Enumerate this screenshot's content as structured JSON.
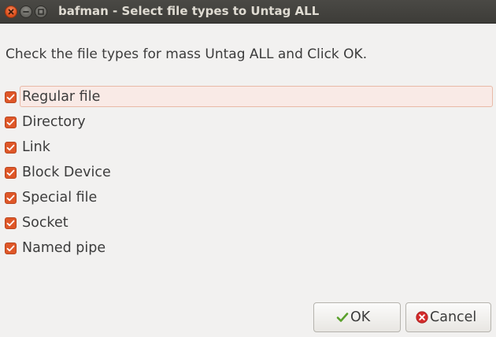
{
  "window": {
    "title": "bafman - Select file types to Untag ALL"
  },
  "instruction": "Check the file types for mass Untag ALL and Click OK.",
  "options": [
    {
      "label": "Regular file",
      "checked": true,
      "focused": true
    },
    {
      "label": "Directory",
      "checked": true,
      "focused": false
    },
    {
      "label": "Link",
      "checked": true,
      "focused": false
    },
    {
      "label": "Block Device",
      "checked": true,
      "focused": false
    },
    {
      "label": "Special file",
      "checked": true,
      "focused": false
    },
    {
      "label": "Socket",
      "checked": true,
      "focused": false
    },
    {
      "label": "Named pipe",
      "checked": true,
      "focused": false
    }
  ],
  "buttons": {
    "ok_label": "OK",
    "ok_icon": "checkmark-icon",
    "cancel_label": "Cancel",
    "cancel_icon": "cancel-icon"
  },
  "colors": {
    "accent": "#df5728",
    "titlebar": "#3d3c38",
    "background": "#f2f1f0",
    "ok_icon": "#5aa02c",
    "cancel_icon": "#d42b2b"
  }
}
